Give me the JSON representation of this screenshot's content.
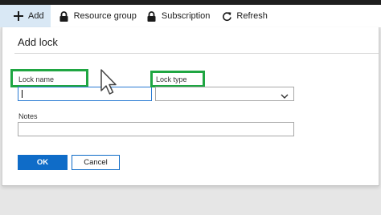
{
  "toolbar": {
    "add_label": "Add",
    "resource_group_label": "Resource group",
    "subscription_label": "Subscription",
    "refresh_label": "Refresh"
  },
  "blade": {
    "title": "Add lock",
    "lock_name_label": "Lock name",
    "lock_name_value": "",
    "lock_type_label": "Lock type",
    "lock_type_value": "",
    "notes_label": "Notes",
    "notes_value": "",
    "ok_label": "OK",
    "cancel_label": "Cancel"
  },
  "colors": {
    "highlight": "#1fa642",
    "primary": "#0f6cc8",
    "focus_border": "#2a7bd3"
  },
  "icons": [
    "plus-icon",
    "lock-icon",
    "refresh-icon",
    "chevron-down-icon",
    "mouse-pointer-icon"
  ]
}
